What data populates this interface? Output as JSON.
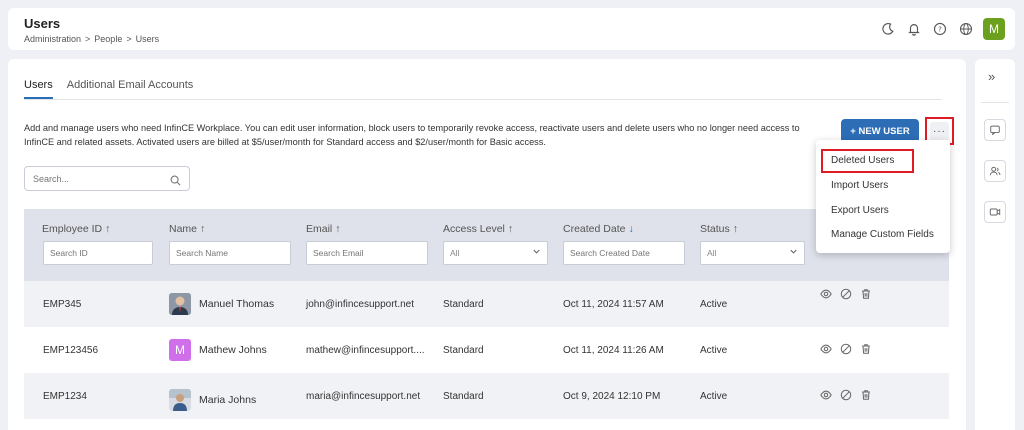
{
  "header": {
    "title": "Users",
    "breadcrumb": [
      "Administration",
      ">",
      "People",
      ">",
      "Users"
    ],
    "avatar_letter": "M",
    "avatar_color": "#6ba11f",
    "icons": [
      "moon-icon",
      "bell-icon",
      "help-icon",
      "globe-icon"
    ]
  },
  "tabs": [
    {
      "label": "Users",
      "active": true
    },
    {
      "label": "Additional Email Accounts",
      "active": false
    }
  ],
  "description": "Add and manage users who need InfinCE Workplace. You can edit user information, block users to temporarily revoke access, reactivate users and delete users who no longer need access to InfinCE and related assets. Activated users are billed at  $5/user/month for Standard access and $2/user/month for Basic access.",
  "search": {
    "placeholder": "Search..."
  },
  "buttons": {
    "new_user": "+ NEW USER",
    "more": "···"
  },
  "colors": {
    "primary": "#2d6db6",
    "highlight": "#e01b24",
    "table_header": "#dfe2ea"
  },
  "table": {
    "columns": [
      {
        "label": "Employee ID",
        "sort": "↑",
        "filter": "Search ID"
      },
      {
        "label": "Name",
        "sort": "↑",
        "filter": "Search Name"
      },
      {
        "label": "Email",
        "sort": "↑",
        "filter": "Search Email"
      },
      {
        "label": "Access Level",
        "sort": "↑",
        "filter": "All"
      },
      {
        "label": "Created Date",
        "sort": "↓",
        "filter": "Search Created Date"
      },
      {
        "label": "Status",
        "sort": "↑",
        "filter": "All"
      }
    ],
    "rows": [
      {
        "id": "EMP345",
        "name": "Manuel Thomas",
        "avatar": "photo",
        "email": "john@infincesupport.net",
        "access": "Standard",
        "created": "Oct 11, 2024 11:57 AM",
        "status": "Active"
      },
      {
        "id": "EMP123456",
        "name": "Mathew Johns",
        "avatar": "M",
        "email": "mathew@infincesupport....",
        "access": "Standard",
        "created": "Oct 11, 2024 11:26 AM",
        "status": "Active"
      },
      {
        "id": "EMP1234",
        "name": "Maria Johns",
        "avatar": "photo",
        "email": "maria@infincesupport.net",
        "access": "Standard",
        "created": "Oct 9, 2024 12:10 PM",
        "status": "Active"
      }
    ]
  },
  "dropdown": {
    "items": [
      "Deleted Users",
      "Import Users",
      "Export Users",
      "Manage Custom Fields"
    ]
  },
  "rightbar": {
    "collapse_glyph": "»"
  }
}
